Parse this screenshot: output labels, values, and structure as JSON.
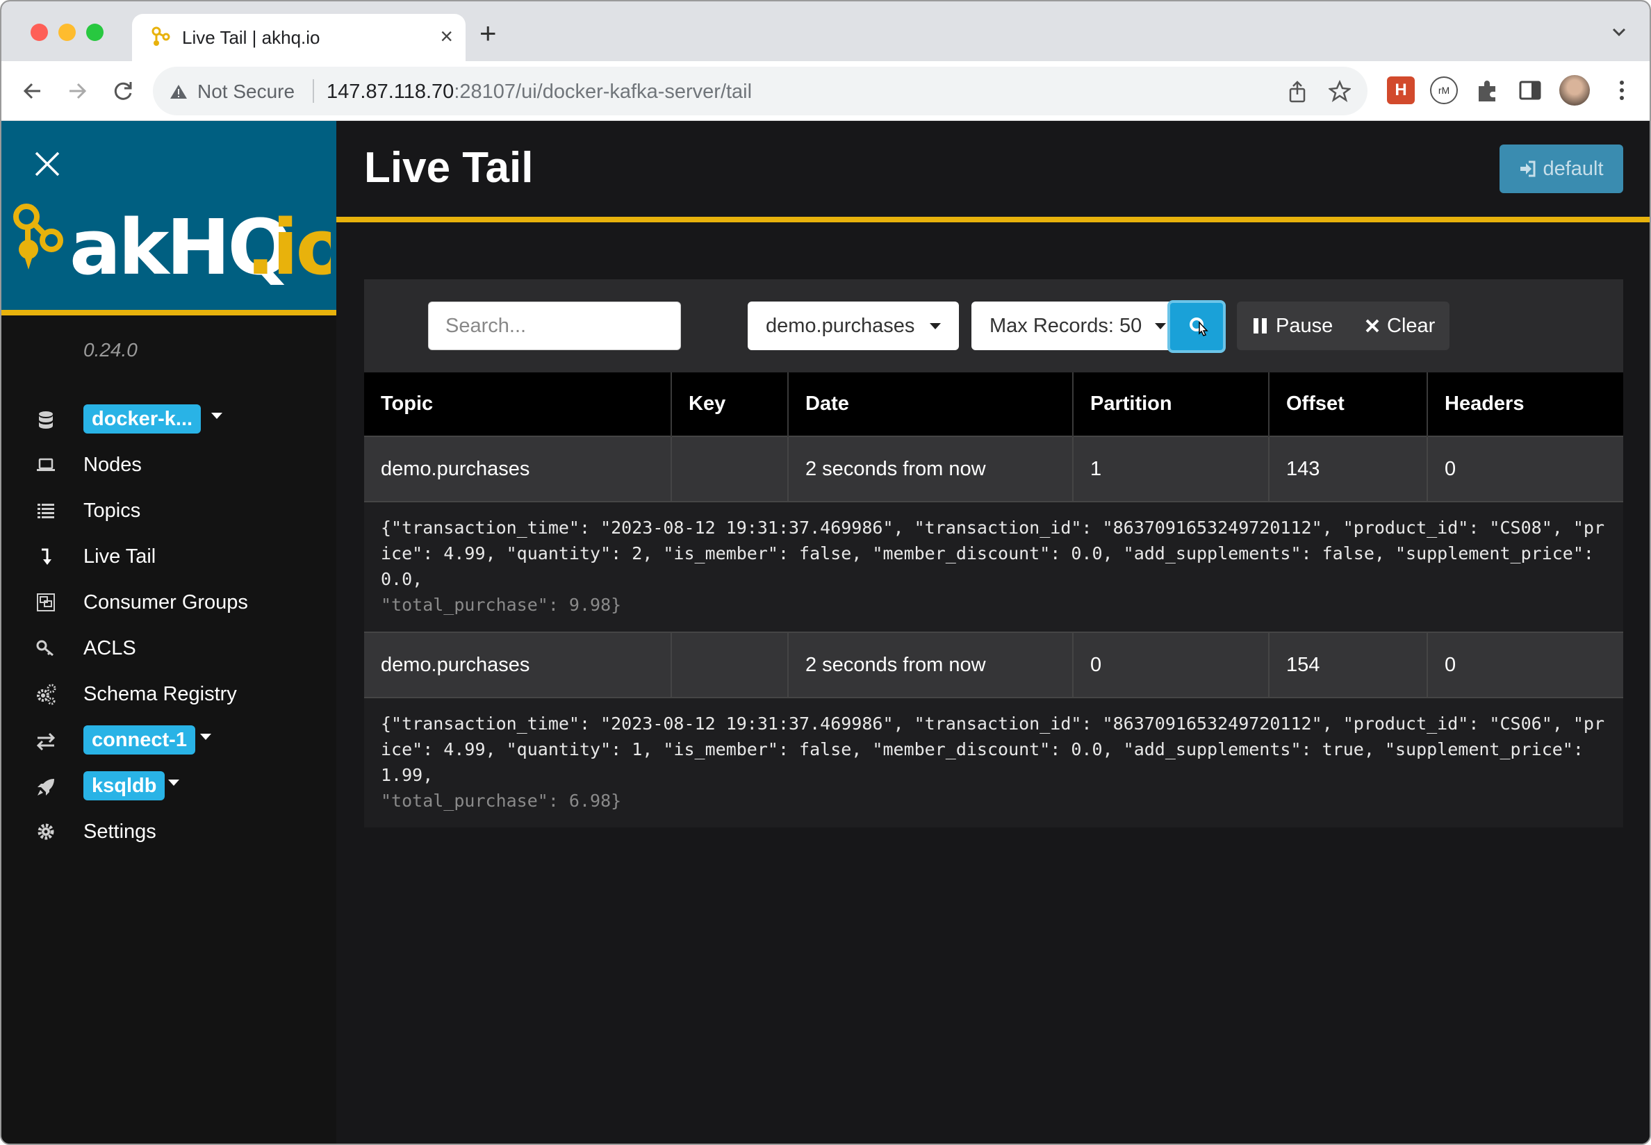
{
  "browser": {
    "tab_title": "Live Tail | akhq.io",
    "security_label": "Not Secure",
    "url_host": "147.87.118.70",
    "url_rest": ":28107/ui/docker-kafka-server/tail"
  },
  "sidebar": {
    "logo_text": "akhq.io",
    "version": "0.24.0",
    "cluster_badge": "docker-k...",
    "items": {
      "nodes": "Nodes",
      "topics": "Topics",
      "live_tail": "Live Tail",
      "consumer_groups": "Consumer Groups",
      "acls": "ACLS",
      "schema_registry": "Schema Registry",
      "settings": "Settings"
    },
    "connect_badge": "connect-1",
    "ksqldb_badge": "ksqldb"
  },
  "header": {
    "title": "Live Tail",
    "default_button": "default"
  },
  "controls": {
    "search_placeholder": "Search...",
    "topic_select": "demo.purchases",
    "max_records_select": "Max Records: 50",
    "pause_label": "Pause",
    "clear_label": "Clear"
  },
  "table": {
    "columns": [
      "Topic",
      "Key",
      "Date",
      "Partition",
      "Offset",
      "Headers"
    ],
    "rows": [
      {
        "topic": "demo.purchases",
        "key": "",
        "date": "2 seconds from now",
        "partition": "1",
        "offset": "143",
        "headers": "0",
        "payload_main": "{\"transaction_time\": \"2023-08-12 19:31:37.469986\", \"transaction_id\": \"8637091653249720112\", \"product_id\": \"CS08\", \"price\": 4.99, \"quantity\": 2, \"is_member\": false, \"member_discount\": 0.0, \"add_supplements\": false, \"supplement_price\": 0.0,",
        "payload_tail": "\"total_purchase\": 9.98}"
      },
      {
        "topic": "demo.purchases",
        "key": "",
        "date": "2 seconds from now",
        "partition": "0",
        "offset": "154",
        "headers": "0",
        "payload_main": "{\"transaction_time\": \"2023-08-12 19:31:37.469986\", \"transaction_id\": \"8637091653249720112\", \"product_id\": \"CS06\", \"price\": 4.99, \"quantity\": 1, \"is_member\": false, \"member_discount\": 0.0, \"add_supplements\": true, \"supplement_price\": 1.99,",
        "payload_tail": "\"total_purchase\": 6.98}"
      }
    ]
  },
  "colors": {
    "brand_blue": "#005f81",
    "accent_yellow": "#e8b20c",
    "badge_blue": "#29b3e6",
    "search_button": "#1aa1d8"
  }
}
